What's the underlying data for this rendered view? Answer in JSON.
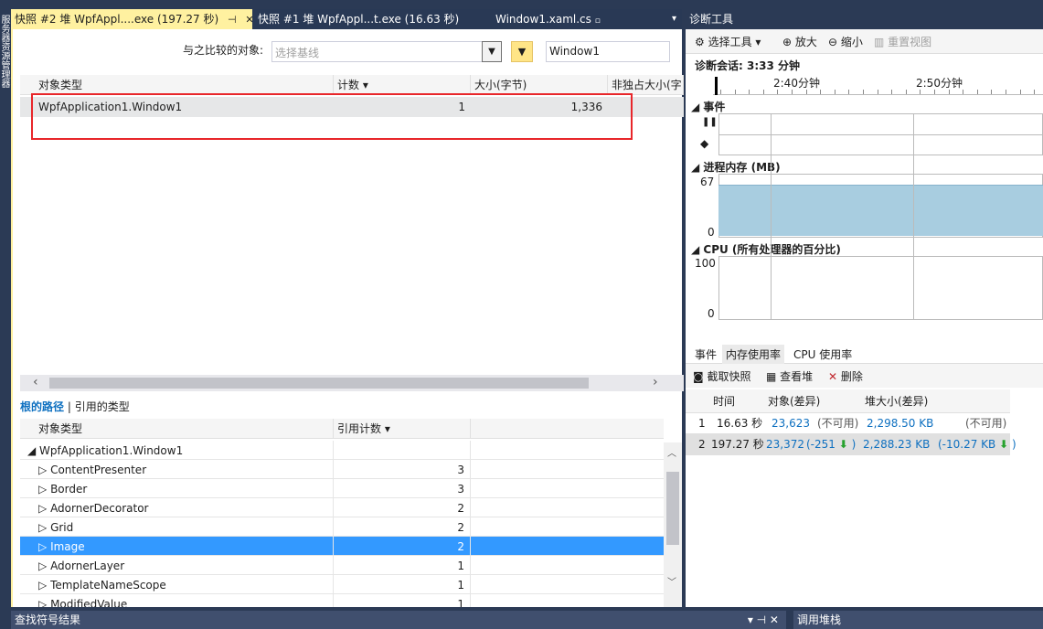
{
  "left_strip": "服务器资源管理器",
  "tabs": [
    {
      "label": "快照 #2 堆 WpfAppl....exe (197.27 秒)",
      "pin": "⊣",
      "close": "✕"
    },
    {
      "label": "快照 #1 堆 WpfAppl...t.exe (16.63 秒)"
    },
    {
      "label": "Window1.xaml.cs",
      "lock": "🔒"
    }
  ],
  "tab_menu": "▾",
  "compare": {
    "label": "与之比较的对象:",
    "placeholder": "选择基线",
    "filter_value": "Window1"
  },
  "table1": {
    "headers": [
      "对象类型",
      "计数 ▾",
      "大小(字节)",
      "非独占大小(字"
    ],
    "rows": [
      {
        "type": "WpfApplication1.Window1",
        "count": "1",
        "size": "1,336"
      }
    ]
  },
  "mid_tabs": {
    "active": "根的路径",
    "sep": "|",
    "other": "引用的类型"
  },
  "table2": {
    "headers": [
      "对象类型",
      "引用计数 ▾"
    ],
    "root": "WpfApplication1.Window1",
    "rows": [
      {
        "name": "ContentPresenter",
        "count": "3"
      },
      {
        "name": "Border",
        "count": "3"
      },
      {
        "name": "AdornerDecorator",
        "count": "2"
      },
      {
        "name": "Grid",
        "count": "2"
      },
      {
        "name": "Image",
        "count": "2",
        "selected": true
      },
      {
        "name": "AdornerLayer",
        "count": "1"
      },
      {
        "name": "TemplateNameScope",
        "count": "1"
      },
      {
        "name": "ModifiedValue",
        "count": "1"
      }
    ]
  },
  "diag": {
    "title": "诊断工具",
    "tools": {
      "select": "选择工具",
      "zoom_in": "放大",
      "zoom_out": "缩小",
      "reset": "重置视图"
    },
    "session": "诊断会话: 3:33 分钟",
    "ruler": [
      "2:40分钟",
      "2:50分钟"
    ],
    "events": "事件",
    "memory": "进程内存 (MB)",
    "mem_max": "67",
    "mem_min": "0",
    "cpu": "CPU (所有处理器的百分比)",
    "cpu_max": "100",
    "cpu_min": "0",
    "bottom_tabs": [
      "事件",
      "内存使用率",
      "CPU 使用率"
    ],
    "actions": {
      "snap": "截取快照",
      "heap": "查看堆",
      "del": "删除"
    },
    "snap_headers": [
      "时间",
      "对象(差异)",
      "堆大小(差异)"
    ],
    "snapshots": [
      {
        "id": "1",
        "time": "16.63 秒",
        "objects": "23,623",
        "obj_diff": "(不可用)",
        "heap": "2,298.50 KB",
        "heap_diff": "(不可用)"
      },
      {
        "id": "2",
        "time": "197.27 秒",
        "objects": "23,372",
        "obj_diff": "(-251",
        "heap": "2,288.23 KB",
        "heap_diff": "(-10.27 KB",
        "arrow": "⬇"
      }
    ]
  },
  "bottom": {
    "find": "查找符号结果",
    "callstack": "调用堆栈"
  }
}
